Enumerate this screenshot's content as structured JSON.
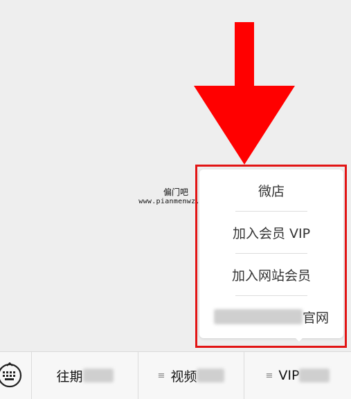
{
  "colors": {
    "arrow": "#ff0000",
    "highlight_border": "#e21414",
    "background": "#eeeeee",
    "popup_background": "#ffffff",
    "bottom_bar": "#f7f7f7"
  },
  "watermark": {
    "name": "偏门吧",
    "url": "www.pianmenwz.com"
  },
  "popup_menu": {
    "items": [
      {
        "label": "微店",
        "redacted_prefix": false
      },
      {
        "label": "加入会员 VIP",
        "redacted_prefix": false
      },
      {
        "label": "加入网站会员",
        "redacted_prefix": false
      },
      {
        "label": "官网",
        "redacted_prefix": true
      }
    ]
  },
  "bottom_bar": {
    "keyboard_icon": "keyboard-icon",
    "tabs": [
      {
        "label": "往期",
        "has_menu_glyph": false,
        "redacted_suffix": true
      },
      {
        "label": "视频",
        "has_menu_glyph": true,
        "redacted_suffix": true
      },
      {
        "label": "VIP",
        "has_menu_glyph": true,
        "redacted_suffix": true
      }
    ]
  }
}
